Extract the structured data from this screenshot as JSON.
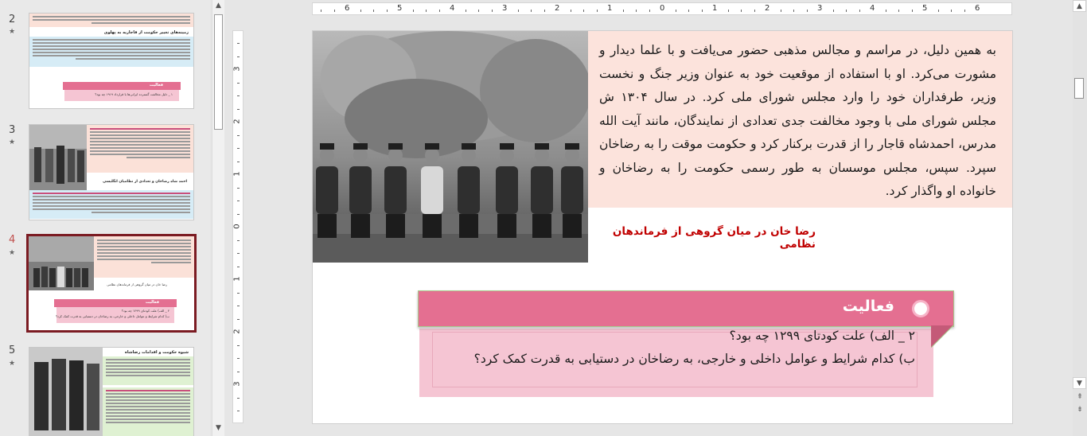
{
  "thumbnails": [
    {
      "number": "2",
      "star": "★"
    },
    {
      "number": "3",
      "star": "★"
    },
    {
      "number": "4",
      "star": "★",
      "active": true
    },
    {
      "number": "5",
      "star": "★"
    }
  ],
  "thumb_labels": {
    "t2_heading": "زمینه‌های تغییر حکومت از قاجاریه به پهلوی",
    "t2_activity": "فعالیت",
    "t2_q": "۱ _ دلیل مخالفت گسترده ایرانی‌ها با قرارداد ۱۹۱۹ چه بود؟",
    "t3_caption": "احمد شاه رضاخان و تعدادی از نظامیان انگلیسی",
    "t4_caption": "رضا خان در میان گروهی از فرماندهان نظامی",
    "t4_activity": "فعالیت",
    "t4_q1": "۲ _ الف) علت کودتای ۱۲۹۹ چه بود؟",
    "t4_q2": "ب) کدام شرایط و عوامل داخلی و خارجی، به رضاخان در دستیابی به قدرت کمک کرد؟",
    "t5_heading": "شیوه حکومت و اقدامات رضاشاه"
  },
  "ruler": {
    "h_numbers": [
      "6",
      "5",
      "4",
      "3",
      "2",
      "1",
      "0",
      "1",
      "2",
      "3",
      "4",
      "5",
      "6"
    ],
    "v_numbers": [
      "3",
      "2",
      "1",
      "0",
      "1",
      "2",
      "3"
    ]
  },
  "slide": {
    "paragraph": "به همین دلیل، در مراسم و مجالس مذهبی حضور می‌یافت و با علما دیدار و مشورت می‌کرد. او با استفاده از موقعیت خود به عنوان وزیر جنگ و نخست وزیر، طرفداران خود را وارد مجلس شورای ملی کرد. در سال ۱۳۰۴ ش مجلس شورای ملی با وجود مخالفت جدی تعدادی از نمایندگان، مانند آیت الله مدرس، احمدشاه قاجار را از قدرت برکنار کرد و حکومت موقت را به رضاخان سپرد. سپس، مجلس موسسان به طور رسمی حکومت را به رضاخان و خانواده او واگذار کرد.",
    "caption": "رضا خان در میان گروهی از فرماندهان نظامی",
    "activity_title": "فعالیت",
    "question_1": "۲ _ الف) علت کودتای ۱۲۹۹ چه بود؟",
    "question_2": "ب) کدام شرایط و عوامل داخلی و خارجی، به رضاخان در دستیابی به قدرت کمک کرد؟"
  },
  "colors": {
    "text_box_bg": "#fce3dc",
    "caption_red": "#c00000",
    "activity_pink": "#e46f91",
    "activity_panel": "#f5c5d3",
    "active_thumb_border": "#7b1b22"
  },
  "icons": {
    "scroll_up": "▲",
    "scroll_down": "▼",
    "prev_slide": "⇞",
    "next_slide": "⇟"
  }
}
